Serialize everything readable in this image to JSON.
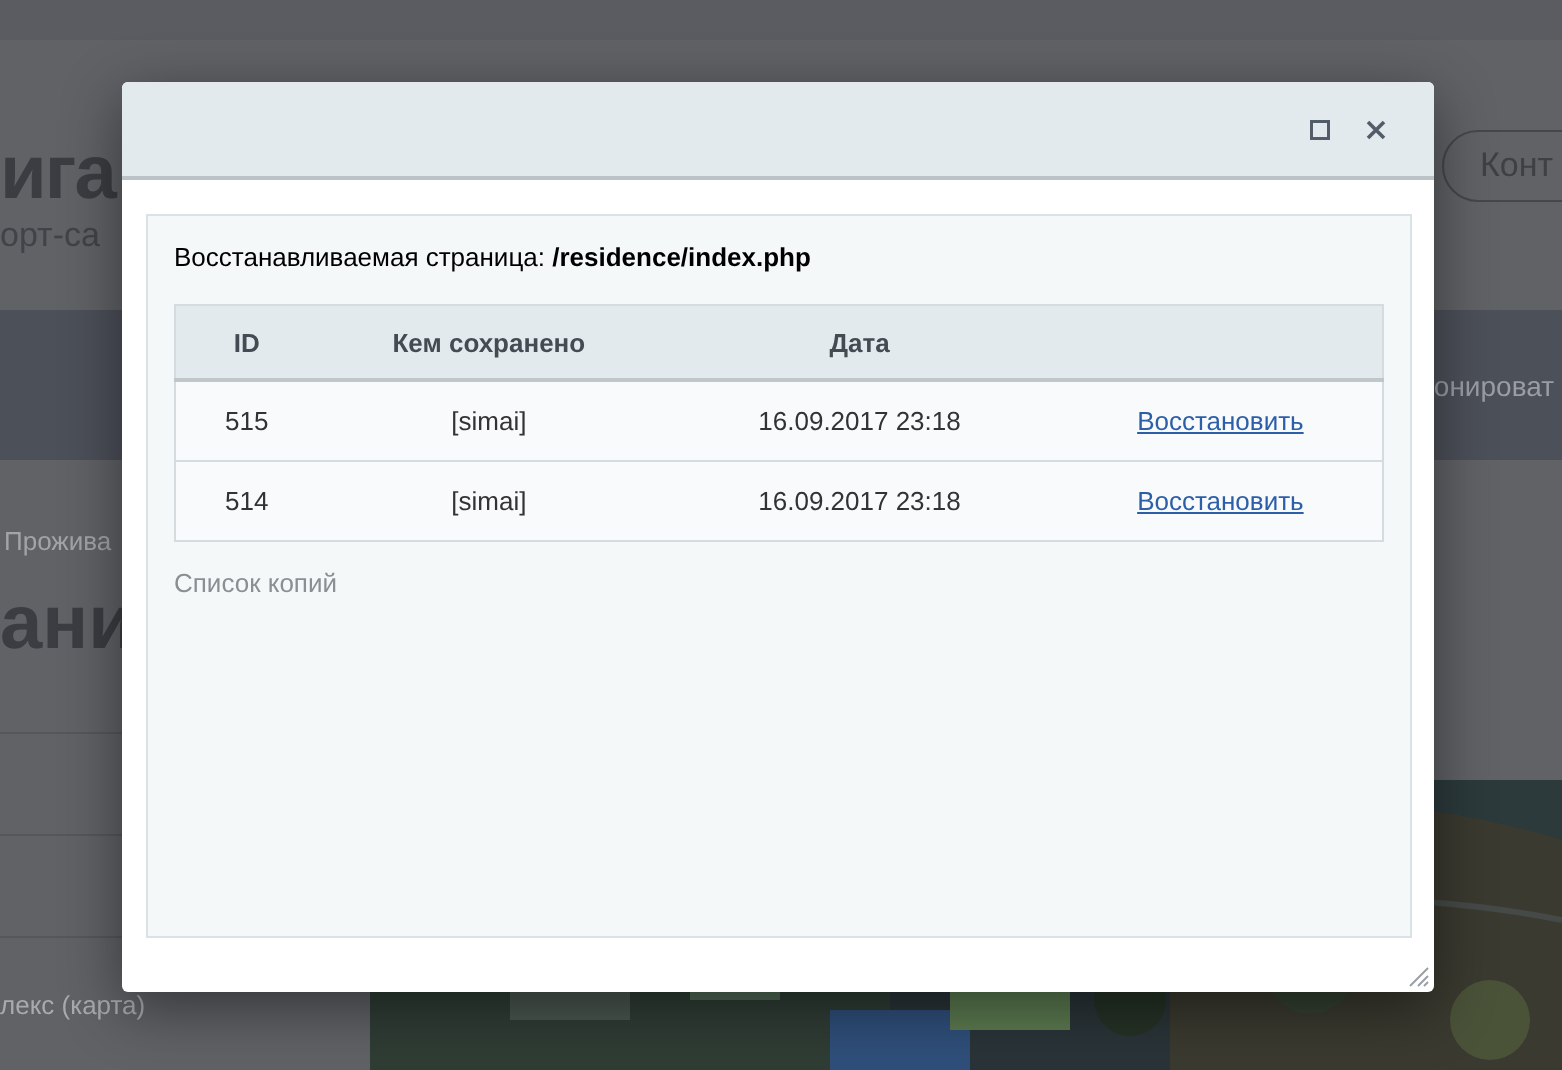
{
  "background": {
    "logo_fragment": "ига",
    "tagline_fragment": "орт-са",
    "contact_button": "Конт",
    "nav_fragment": "онироват",
    "breadcrumb_fragment": "Прожива",
    "heading_fragment": "ани",
    "menu_item_fragment": "лекс (карта)"
  },
  "dialog": {
    "title_label": "Восстанавливаемая страница: **/residence/index.php**",
    "table": {
      "columns": [
        "ID",
        "Кем сохранено",
        "Дата"
      ],
      "rows": [
        {
          "id": "515",
          "author": "[simai]",
          "date": "16.09.2017 23:18",
          "action": "Восстановить"
        },
        {
          "id": "514",
          "author": "[simai]",
          "date": "16.09.2017 23:18",
          "action": "Восстановить"
        }
      ]
    },
    "footer_label": "Список копий"
  }
}
